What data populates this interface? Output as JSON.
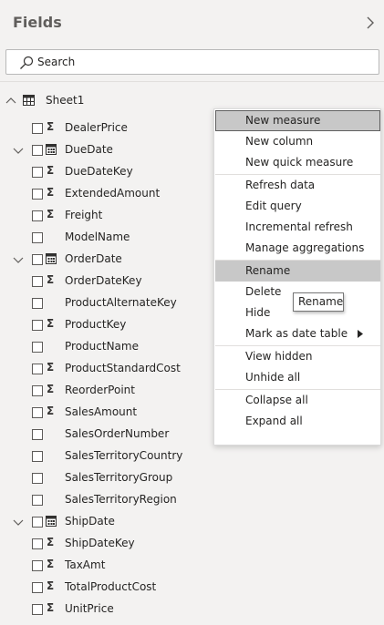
{
  "panel": {
    "title": "Fields"
  },
  "search": {
    "placeholder": "Search",
    "value": ""
  },
  "table": {
    "name": "Sheet1"
  },
  "fields": [
    {
      "label": "DealerPrice",
      "kind": "sigma"
    },
    {
      "label": "DueDate",
      "kind": "date",
      "expandable": true
    },
    {
      "label": "DueDateKey",
      "kind": "sigma"
    },
    {
      "label": "ExtendedAmount",
      "kind": "sigma"
    },
    {
      "label": "Freight",
      "kind": "sigma"
    },
    {
      "label": "ModelName",
      "kind": "text"
    },
    {
      "label": "OrderDate",
      "kind": "date",
      "expandable": true
    },
    {
      "label": "OrderDateKey",
      "kind": "sigma"
    },
    {
      "label": "ProductAlternateKey",
      "kind": "text"
    },
    {
      "label": "ProductKey",
      "kind": "sigma"
    },
    {
      "label": "ProductName",
      "kind": "text"
    },
    {
      "label": "ProductStandardCost",
      "kind": "sigma"
    },
    {
      "label": "ReorderPoint",
      "kind": "sigma"
    },
    {
      "label": "SalesAmount",
      "kind": "sigma"
    },
    {
      "label": "SalesOrderNumber",
      "kind": "text"
    },
    {
      "label": "SalesTerritoryCountry",
      "kind": "text"
    },
    {
      "label": "SalesTerritoryGroup",
      "kind": "text"
    },
    {
      "label": "SalesTerritoryRegion",
      "kind": "text"
    },
    {
      "label": "ShipDate",
      "kind": "date",
      "expandable": true
    },
    {
      "label": "ShipDateKey",
      "kind": "sigma"
    },
    {
      "label": "TaxAmt",
      "kind": "sigma"
    },
    {
      "label": "TotalProductCost",
      "kind": "sigma"
    },
    {
      "label": "UnitPrice",
      "kind": "sigma"
    }
  ],
  "context_menu": {
    "items": [
      {
        "label": "New measure",
        "state": "focus"
      },
      {
        "label": "New column"
      },
      {
        "label": "New quick measure"
      },
      {
        "sep": true
      },
      {
        "label": "Refresh data"
      },
      {
        "label": "Edit query"
      },
      {
        "label": "Incremental refresh"
      },
      {
        "label": "Manage aggregations"
      },
      {
        "sep": true
      },
      {
        "label": "Rename",
        "state": "hover"
      },
      {
        "label": "Delete"
      },
      {
        "label": "Hide"
      },
      {
        "label": "Mark as date table",
        "submenu": true
      },
      {
        "sep": true
      },
      {
        "label": "View hidden"
      },
      {
        "label": "Unhide all"
      },
      {
        "sep": true
      },
      {
        "label": "Collapse all"
      },
      {
        "label": "Expand all"
      }
    ]
  },
  "tooltip": {
    "text": "Rename"
  },
  "colors": {
    "panel_bg": "#f3f2f1",
    "menu_highlight": "#c8c8c8",
    "text": "#252423"
  }
}
